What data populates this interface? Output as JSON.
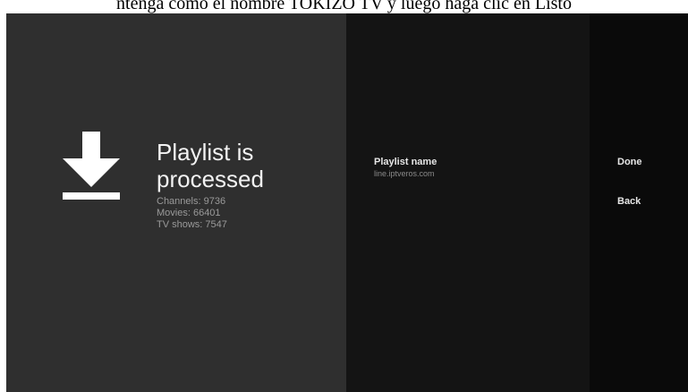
{
  "caption": "ntenga como el nombre TOKIZO TV y luego haga clic en Listo",
  "status": {
    "title": "Playlist is processed",
    "stats": [
      "Channels: 9736",
      "Movies: 66401",
      "TV shows: 7547"
    ]
  },
  "playlist": {
    "label": "Playlist name",
    "value": "line.iptveros.com"
  },
  "actions": {
    "done": "Done",
    "back": "Back"
  },
  "colors": {
    "left_pane": "#2f2f2f",
    "middle_pane": "#141414",
    "right_pane": "#0a0a0a"
  },
  "icons": {
    "status": "download-icon"
  }
}
